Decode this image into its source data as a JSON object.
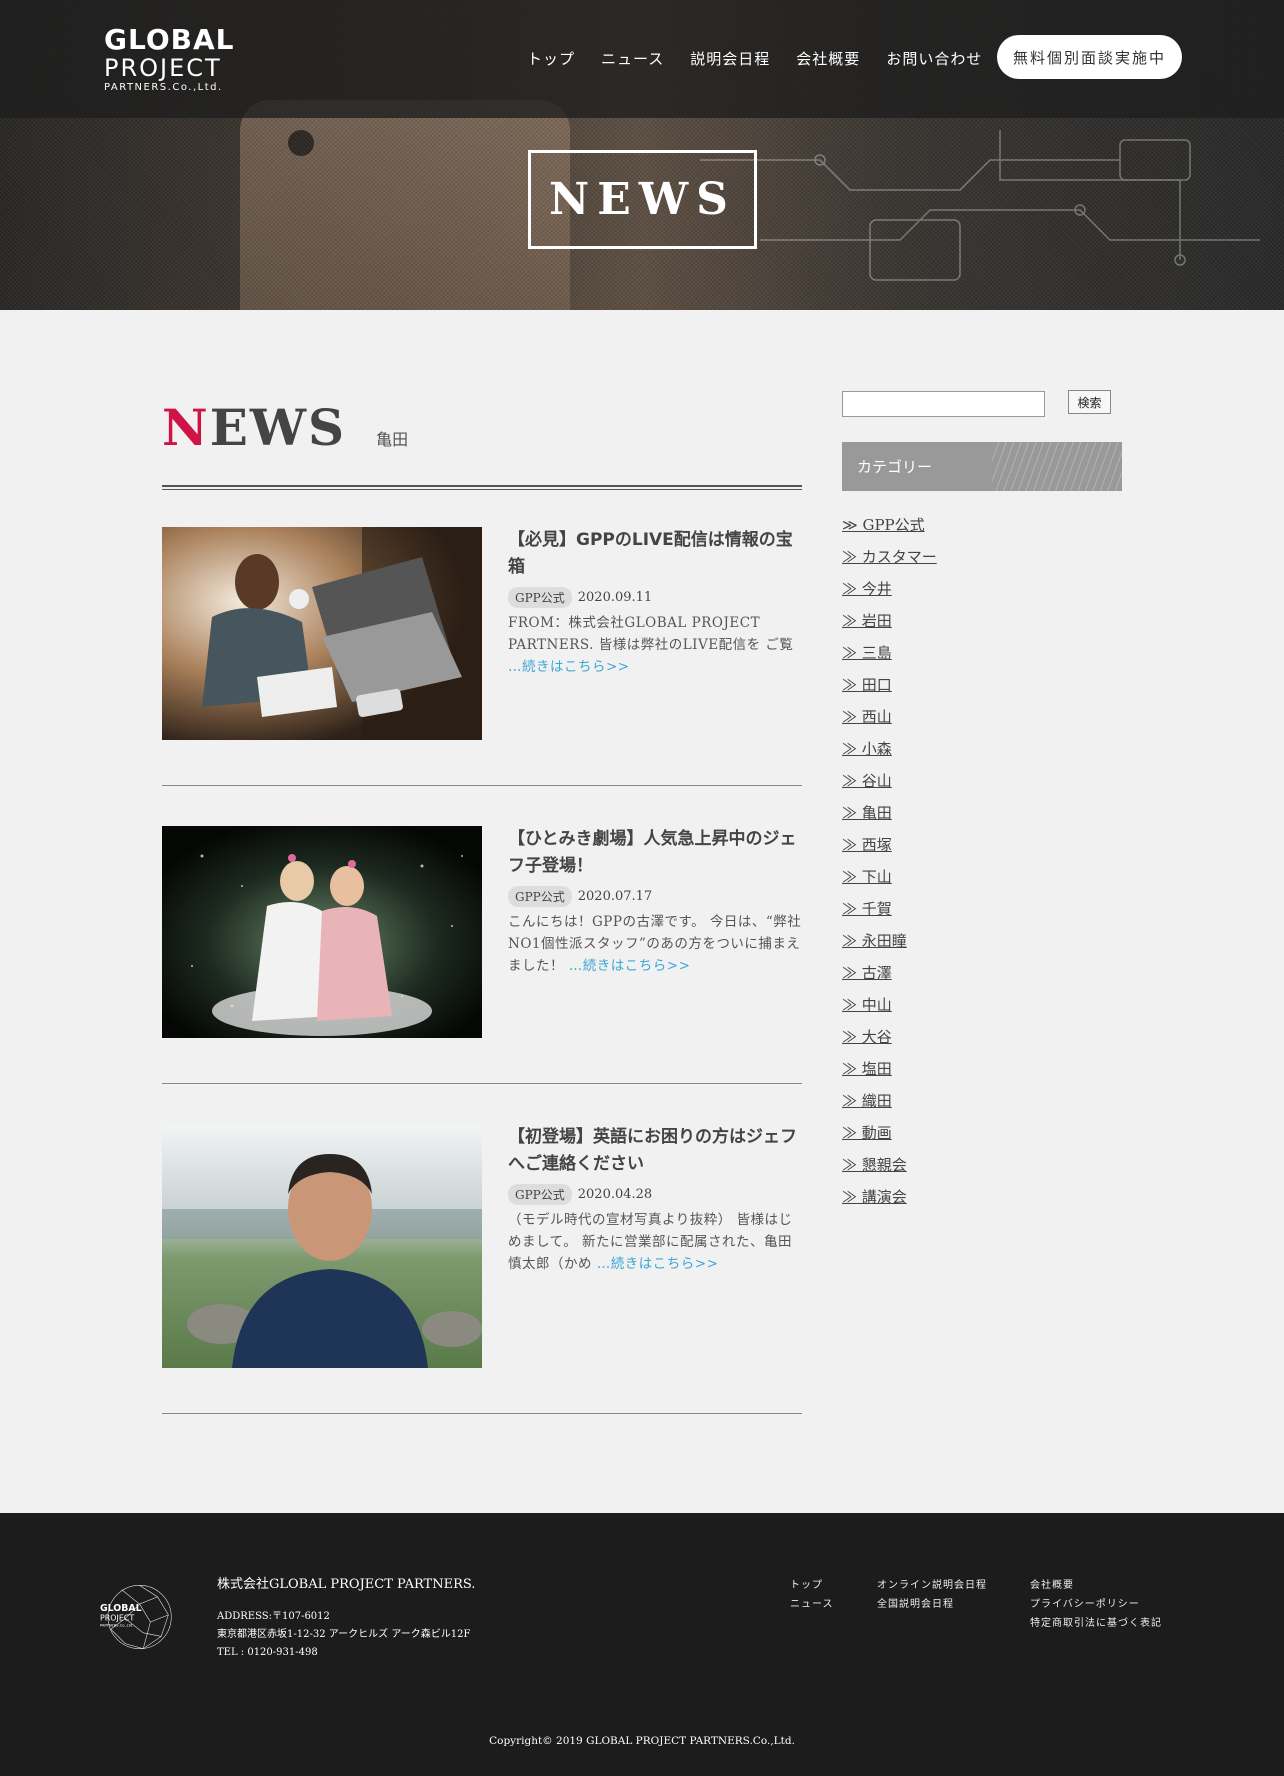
{
  "header": {
    "logo": {
      "line1": "GLOBAL",
      "line2": "PROJECT",
      "line3": "PARTNERS.Co.,Ltd."
    },
    "nav": [
      "トップ",
      "ニュース",
      "説明会日程",
      "会社概要",
      "お問い合わせ"
    ],
    "cta": "無料個別面談実施中"
  },
  "hero": {
    "title": "NEWS"
  },
  "main": {
    "heading_initial": "N",
    "heading_rest": "EWS",
    "heading_sub": "亀田",
    "posts": [
      {
        "title": "【必見】GPPのLIVE配信は情報の宝箱",
        "category": "GPP公式",
        "date": "2020.09.11",
        "excerpt": "FROM：株式会社GLOBAL PROJECT PARTNERS. 皆様は弊社のLIVE配信を ご覧 ",
        "more": "…続きはこちら>>"
      },
      {
        "title": "【ひとみき劇場】人気急上昇中のジェフ子登場！",
        "category": "GPP公式",
        "date": "2020.07.17",
        "excerpt": "こんにちは！GPPの古澤です。 今日は、“弊社NO1個性派スタッフ”のあの方をついに捕まえました！ ",
        "more": "…続きはこちら>>"
      },
      {
        "title": "【初登場】英語にお困りの方はジェフへご連絡ください",
        "category": "GPP公式",
        "date": "2020.04.28",
        "excerpt": "（モデル時代の宣材写真より抜粋） 皆様はじめまして。 新たに営業部に配属された、亀田　慎太郎（かめ ",
        "more": "…続きはこちら>>"
      }
    ]
  },
  "sidebar": {
    "search_button": "検索",
    "category_heading": "カテゴリー",
    "categories": [
      "≫ GPP公式",
      "≫ カスタマー",
      "≫ 今井",
      "≫ 岩田",
      "≫ 三島",
      "≫ 田口",
      "≫ 西山",
      "≫ 小森",
      "≫ 谷山",
      "≫ 亀田",
      "≫ 西塚",
      "≫ 下山",
      "≫ 千賀",
      "≫ 永田瞳",
      "≫ 古澤",
      "≫ 中山",
      "≫ 大谷",
      "≫ 塩田",
      "≫ 織田",
      "≫ 動画",
      "≫ 懇親会",
      "≫ 講演会"
    ]
  },
  "footer": {
    "logo": {
      "line1": "GLOBAL",
      "line2": "PROJECT",
      "line3": "PARTNERS.Co.,Ltd."
    },
    "company": "株式会社GLOBAL PROJECT PARTNERS.",
    "address1": "ADDRESS:〒107-6012",
    "address2": "東京都港区赤坂1-12-32 アークヒルズ アーク森ビル12F",
    "tel": "TEL : 0120-931-498",
    "col1": [
      "トップ",
      "ニュース"
    ],
    "col2": [
      "オンライン説明会日程",
      "全国説明会日程"
    ],
    "col3": [
      "会社概要",
      "プライバシーポリシー",
      "特定商取引法に基づく表記"
    ],
    "copyright": "Copyright© 2019 GLOBAL PROJECT PARTNERS.Co.,Ltd."
  },
  "colors": {
    "accent": "#d01347",
    "link": "#3aa7d6",
    "footer_bg": "#1c1c1c"
  }
}
